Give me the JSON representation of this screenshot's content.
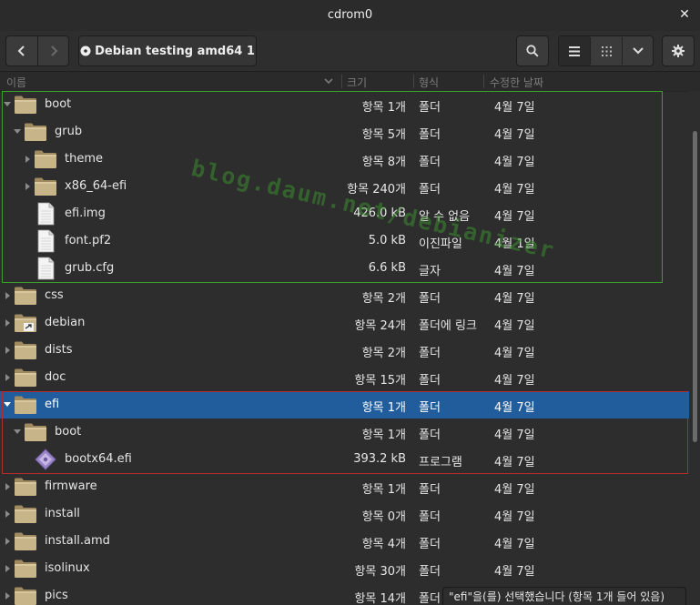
{
  "window": {
    "title": "cdrom0"
  },
  "toolbar": {
    "location_label": "Debian testing amd64 1"
  },
  "columns": {
    "name": "이름",
    "size": "크기",
    "type": "형식",
    "modified": "수정한 날짜"
  },
  "watermark": "blog.daum.net/debianizer",
  "colors": {
    "selection": "#215d9c",
    "green_box": "#3a9f2c",
    "red_box": "#b52c2c",
    "folder": "#c8b489"
  },
  "rows": [
    {
      "name": "boot",
      "size": "항목 1개",
      "type": "폴더",
      "date": "4월 7일",
      "level": 0,
      "expander": "open",
      "icon": "folder-icon"
    },
    {
      "name": "grub",
      "size": "항목 5개",
      "type": "폴더",
      "date": "4월 7일",
      "level": 1,
      "expander": "open",
      "icon": "folder-icon"
    },
    {
      "name": "theme",
      "size": "항목 8개",
      "type": "폴더",
      "date": "4월 7일",
      "level": 2,
      "expander": "closed",
      "icon": "folder-icon"
    },
    {
      "name": "x86_64-efi",
      "size": "항목 240개",
      "type": "폴더",
      "date": "4월 7일",
      "level": 2,
      "expander": "closed",
      "icon": "folder-icon"
    },
    {
      "name": "efi.img",
      "size": "426.0 kB",
      "type": "알 수 없음",
      "date": "4월 7일",
      "level": 2,
      "expander": "none",
      "icon": "file-icon"
    },
    {
      "name": "font.pf2",
      "size": "5.0 kB",
      "type": "이진파일",
      "date": "4월 1일",
      "level": 2,
      "expander": "none",
      "icon": "file-icon"
    },
    {
      "name": "grub.cfg",
      "size": "6.6 kB",
      "type": "글자",
      "date": "4월 7일",
      "level": 2,
      "expander": "none",
      "icon": "file-icon"
    },
    {
      "name": "css",
      "size": "항목 2개",
      "type": "폴더",
      "date": "4월 7일",
      "level": 0,
      "expander": "closed",
      "icon": "folder-icon"
    },
    {
      "name": "debian",
      "size": "항목 24개",
      "type": "폴더에 링크",
      "date": "4월 7일",
      "level": 0,
      "expander": "closed",
      "icon": "folder-link-icon"
    },
    {
      "name": "dists",
      "size": "항목 2개",
      "type": "폴더",
      "date": "4월 7일",
      "level": 0,
      "expander": "closed",
      "icon": "folder-icon"
    },
    {
      "name": "doc",
      "size": "항목 15개",
      "type": "폴더",
      "date": "4월 7일",
      "level": 0,
      "expander": "closed",
      "icon": "folder-icon"
    },
    {
      "name": "efi",
      "size": "항목 1개",
      "type": "폴더",
      "date": "4월 7일",
      "level": 0,
      "expander": "open",
      "icon": "folder-icon",
      "selected": true
    },
    {
      "name": "boot",
      "size": "항목 1개",
      "type": "폴더",
      "date": "4월 7일",
      "level": 1,
      "expander": "open",
      "icon": "folder-icon"
    },
    {
      "name": "bootx64.efi",
      "size": "393.2 kB",
      "type": "프로그램",
      "date": "4월 7일",
      "level": 2,
      "expander": "none",
      "icon": "executable-icon"
    },
    {
      "name": "firmware",
      "size": "항목 1개",
      "type": "폴더",
      "date": "4월 7일",
      "level": 0,
      "expander": "closed",
      "icon": "folder-icon"
    },
    {
      "name": "install",
      "size": "항목 0개",
      "type": "폴더",
      "date": "4월 7일",
      "level": 0,
      "expander": "closed",
      "icon": "folder-icon"
    },
    {
      "name": "install.amd",
      "size": "항목 4개",
      "type": "폴더",
      "date": "4월 7일",
      "level": 0,
      "expander": "closed",
      "icon": "folder-icon"
    },
    {
      "name": "isolinux",
      "size": "항목 30개",
      "type": "폴더",
      "date": "4월 7일",
      "level": 0,
      "expander": "closed",
      "icon": "folder-icon"
    },
    {
      "name": "pics",
      "size": "항목 14개",
      "type": "폴더",
      "date": "",
      "level": 0,
      "expander": "closed",
      "icon": "folder-icon"
    }
  ],
  "status": "\"efi\"을(를) 선택했습니다 (항목 1개 들어 있음)"
}
